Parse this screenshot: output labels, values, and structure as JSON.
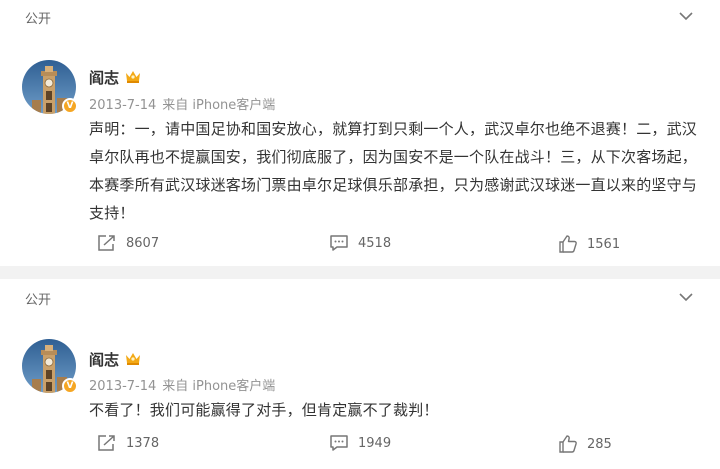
{
  "posts": [
    {
      "visibility": "公开",
      "author": "阎志",
      "date": "2013-7-14",
      "source": "来自 iPhone客户端",
      "text": "声明：一，请中国足协和国安放心，就算打到只剩一个人，武汉卓尔也绝不退赛！二，武汉卓尔队再也不提赢国安，我们彻底服了，因为国安不是一个队在战斗！三，从下次客场起，本赛季所有武汉球迷客场门票由卓尔足球俱乐部承担，只为感谢武汉球迷一直以来的坚守与支持！",
      "reposts": "8607",
      "comments": "4518",
      "likes": "1561"
    },
    {
      "visibility": "公开",
      "author": "阎志",
      "date": "2013-7-14",
      "source": "来自 iPhone客户端",
      "text": "不看了！我们可能赢得了对手，但肯定赢不了裁判！",
      "reposts": "1378",
      "comments": "1949",
      "likes": "285"
    }
  ],
  "icons": {
    "expand": "chevron-down-icon",
    "repost": "repost-icon",
    "comment": "comment-icon",
    "like": "thumbs-up-icon",
    "verified": "verified-badge-icon",
    "member": "crown-icon"
  },
  "colors": {
    "background": "#f2f2f2",
    "card": "#ffffff",
    "text": "#333333",
    "meta": "#939393",
    "badge": "#f5a623"
  }
}
